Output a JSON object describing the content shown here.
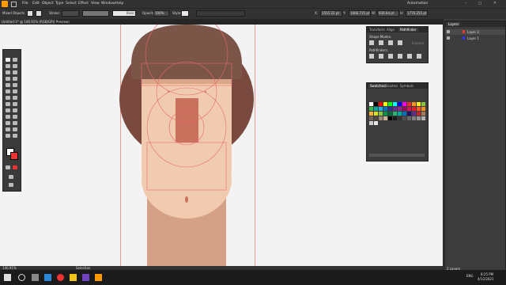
{
  "menu": [
    "File",
    "Edit",
    "Object",
    "Type",
    "Select",
    "Effect",
    "View",
    "Window",
    "Help"
  ],
  "workspace": "Automation",
  "control": {
    "selection": "Mixed Objects",
    "stroke_label": "Stroke:",
    "brush": "Basic",
    "opacity_label": "Opacity:",
    "opacity_value": "100%",
    "style_label": "Style:",
    "x_value": "1555.22 pt",
    "y_value": "1666.735 pt",
    "w_value": "936.64 pt",
    "h_value": "1770.255 pt"
  },
  "document_tab": "Untitled-1* @ 146.91% (RGB/GPU Preview)",
  "status": {
    "zoom": "146.91%",
    "tool": "Selection"
  },
  "pathfinder": {
    "tabs": [
      "Transform",
      "Align",
      "Pathfinder"
    ],
    "shape_modes_label": "Shape Modes:",
    "pathfinders_label": "Pathfinders:",
    "expand_label": "Expand"
  },
  "swatches": {
    "tabs": [
      "Swatches",
      "Brushes",
      "Symbols"
    ],
    "colors": [
      "#ffffff",
      "#000000",
      "#ff0000",
      "#ffff00",
      "#00ff00",
      "#00ffff",
      "#0000ff",
      "#ff00ff",
      "#e62e2e",
      "#f7931e",
      "#fcee21",
      "#8cc63f",
      "#39b54a",
      "#00a99d",
      "#29abe2",
      "#0071bc",
      "#2e3192",
      "#662d91",
      "#93278f",
      "#9e005d",
      "#d4145a",
      "#ed1c24",
      "#f15a24",
      "#f7931e",
      "#fbb03b",
      "#d9e021",
      "#8cc63f",
      "#009245",
      "#006837",
      "#22b573",
      "#00a99d",
      "#0071bc",
      "#1b1464",
      "#662d91",
      "#c1272d",
      "#a67c52",
      "#736357",
      "#534741",
      "#998675",
      "#c7b299",
      "#000000",
      "#1a1a1a",
      "#333333",
      "#4d4d4d",
      "#666666",
      "#808080",
      "#999999",
      "#b3b3b3",
      "#cccccc",
      "#e6e6e6"
    ]
  },
  "layers": {
    "tab": "Layers",
    "items": [
      "Layer 2",
      "Layer 1"
    ],
    "footer": "2 Layers"
  },
  "taskbar": {
    "time": "8:25 PM",
    "date": "4/12/2021",
    "lang": "ENG"
  }
}
